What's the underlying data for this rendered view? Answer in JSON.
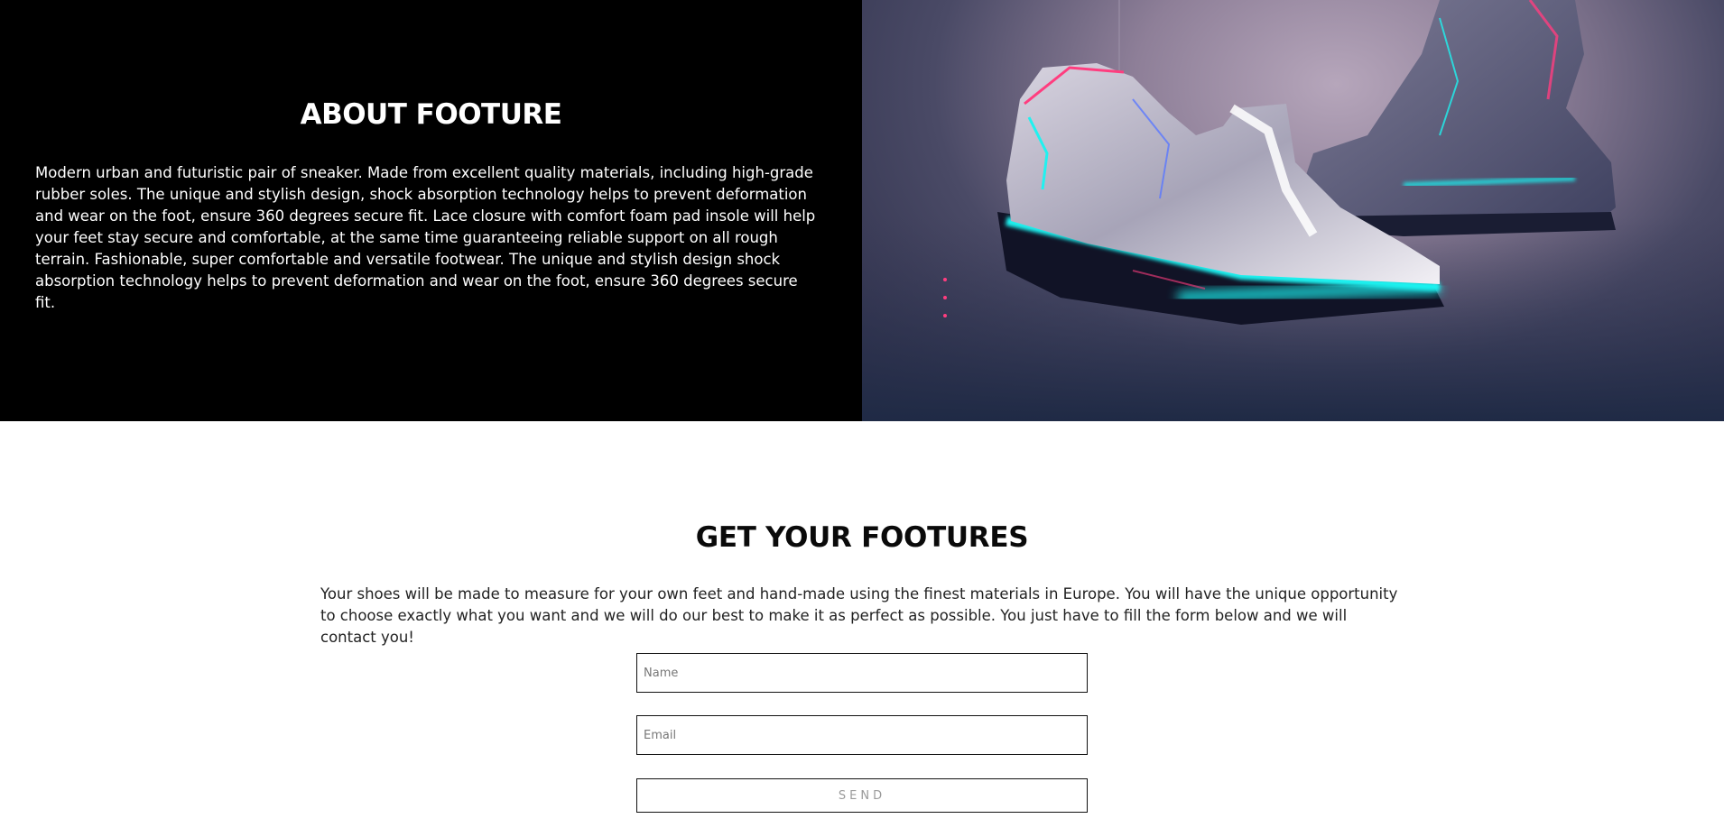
{
  "about": {
    "title": "ABOUT FOOTURE",
    "body": "Modern urban and futuristic pair of sneaker. Made from excellent quality materials, including high-grade rubber soles. The unique and stylish design, shock absorption technology helps to prevent deformation and wear on the foot, ensure 360 degrees secure fit. Lace closure with comfort foam pad insole will help your feet stay secure and comfortable, at the same time guaranteeing reliable support on all rough terrain. Fashionable, super comfortable and versatile footwear. The unique and stylish design shock absorption technology helps to prevent deformation and wear on the foot, ensure 360 degrees secure fit.",
    "image_subject": "futuristic-sneakers-photo"
  },
  "order": {
    "title": "GET YOUR FOOTURES",
    "body": "Your shoes will be made to measure for your own feet and hand-made using the finest materials in Europe. You will have the unique opportunity to choose exactly what you want and we will do our best to make it as perfect as possible. You just have to fill the form below and we will contact you!",
    "name_placeholder": "Name",
    "email_placeholder": "Email",
    "send_label": "SEND"
  },
  "colors": {
    "about_bg": "#000000",
    "glow": "#1ff2f0",
    "accent_pink": "#ff3d7f"
  }
}
